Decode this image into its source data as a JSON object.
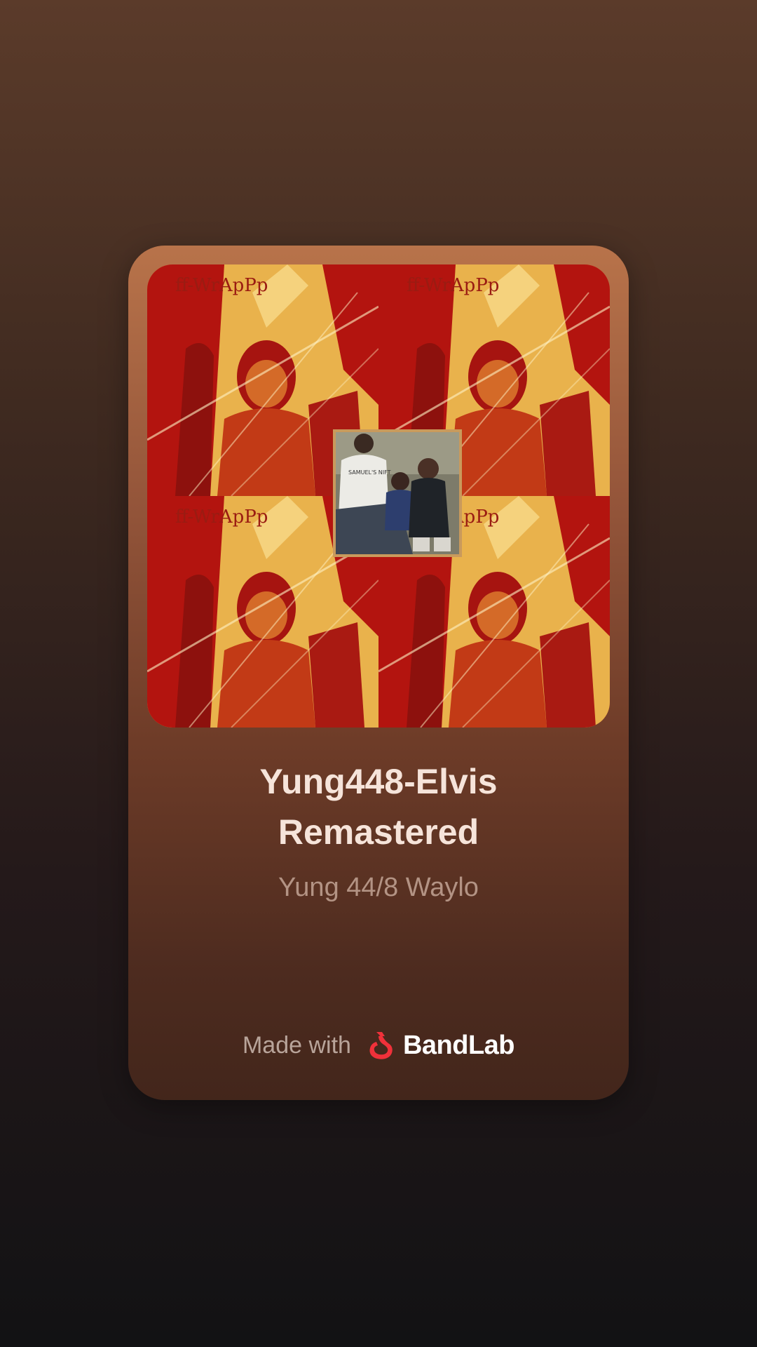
{
  "track": {
    "title_line1": "Yung448-Elvis",
    "title_line2": "Remastered",
    "artist": "Yung 44/8 Waylo"
  },
  "artwork": {
    "tile_caption": "ff-WrApPp",
    "shirt_text": "SAMUEL'S NIFT"
  },
  "footer": {
    "made_with": "Made with",
    "brand": "BandLab"
  },
  "colors": {
    "brand_red": "#f0313a",
    "title_text": "#f6e4da",
    "artist_text": "#b39384"
  }
}
